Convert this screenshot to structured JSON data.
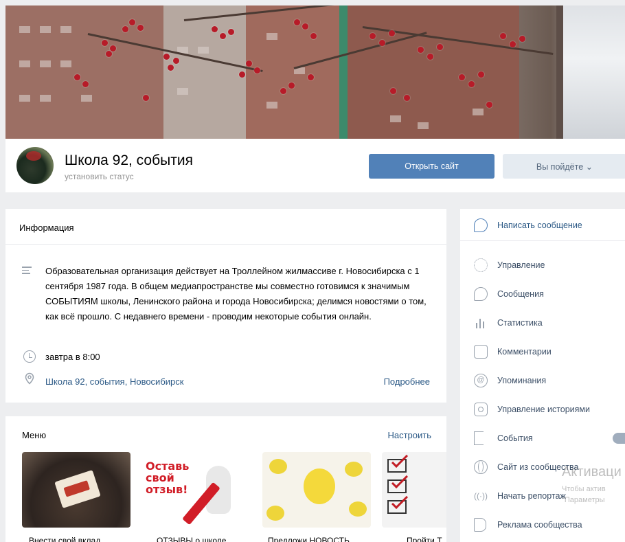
{
  "group": {
    "name": "Школа 92, события",
    "status_placeholder": "установить статус",
    "open_site_button": "Открыть сайт",
    "attend_button": "Вы пойдёте ⌄"
  },
  "info": {
    "heading": "Информация",
    "description": "Образовательная организация действует на Троллейном жилмассиве г. Новосибирска с 1 сентября 1987 года. В общем медиапространстве мы совместно готовимся к значимым СОБЫТИЯМ школы, Ленинского района и города Новосибирска; делимся новостями о том, как всё прошло. С недавнего времени - проводим некоторые события онлайн.",
    "time": "завтра в 8:00",
    "location": "Школа 92, события, Новосибирск",
    "more_link": "Подробнее"
  },
  "menu": {
    "heading": "Меню",
    "settings_link": "Настроить",
    "tiles": [
      {
        "label": "Внести свой вклад"
      },
      {
        "label": "ОТЗЫВЫ о школе",
        "image_text": "Оставь свой отзыв!"
      },
      {
        "label": "Предложи НОВОСТЬ"
      },
      {
        "label": "Пройти Т"
      }
    ]
  },
  "sidebar": {
    "write_message": "Написать сообщение",
    "items": [
      {
        "label": "Управление",
        "icon": "gear-icon"
      },
      {
        "label": "Сообщения",
        "icon": "message-icon"
      },
      {
        "label": "Статистика",
        "icon": "stats-icon"
      },
      {
        "label": "Комментарии",
        "icon": "comment-icon"
      },
      {
        "label": "Упоминания",
        "icon": "at-icon"
      },
      {
        "label": "Управление историями",
        "icon": "stories-icon"
      },
      {
        "label": "События",
        "icon": "event-icon"
      },
      {
        "label": "Сайт из сообщества",
        "icon": "globe-icon"
      },
      {
        "label": "Начать репортаж",
        "icon": "live-icon"
      },
      {
        "label": "Реклама сообщества",
        "icon": "ads-icon"
      }
    ]
  },
  "watermark": {
    "title": "Активаци",
    "line1": "Чтобы актив",
    "line2": "\"Параметры"
  },
  "colors": {
    "accent": "#5181b8",
    "link": "#2a5885",
    "background": "#edeef0"
  }
}
